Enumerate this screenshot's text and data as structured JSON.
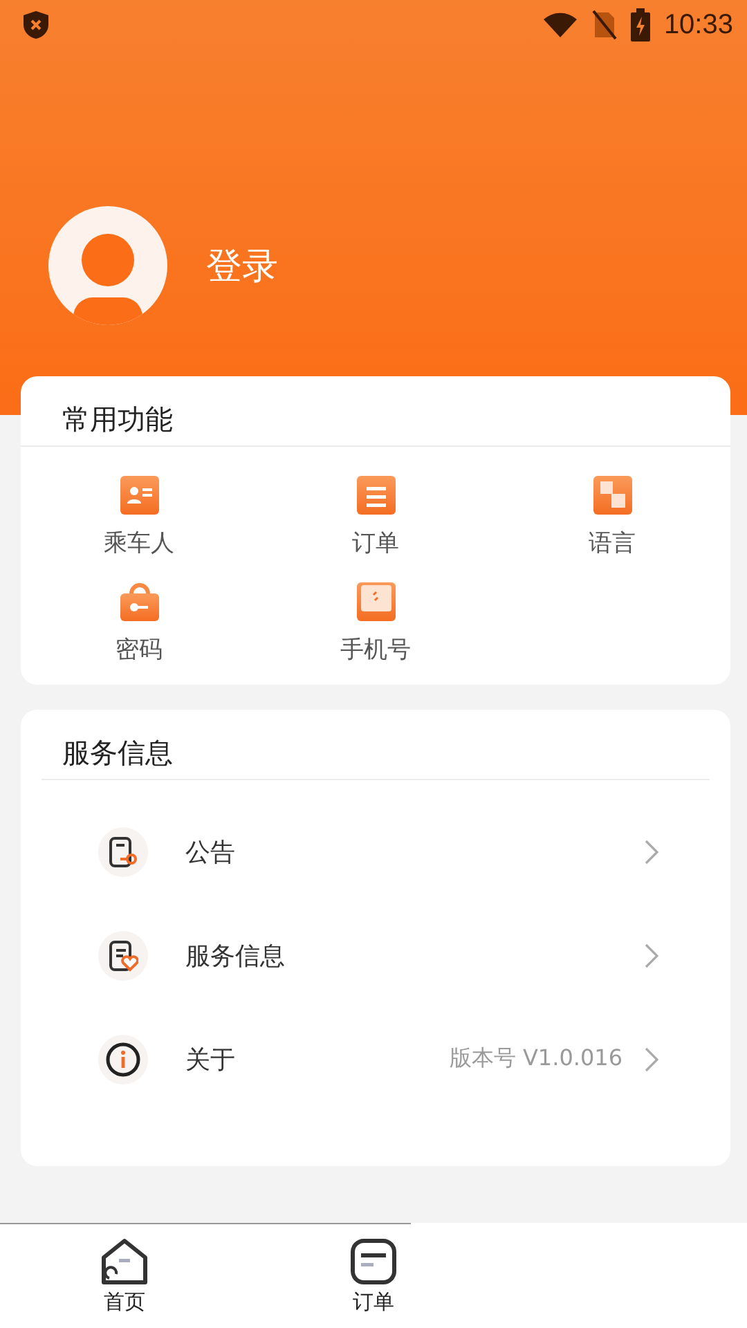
{
  "status_bar": {
    "time": "10:33"
  },
  "profile": {
    "login": "登录"
  },
  "common_functions": {
    "title": "常用功能",
    "items": [
      {
        "label": "乘车人"
      },
      {
        "label": "订单"
      },
      {
        "label": "语言"
      },
      {
        "label": "密码"
      },
      {
        "label": "手机号"
      }
    ]
  },
  "service_info": {
    "title": "服务信息",
    "rows": [
      {
        "label": "公告"
      },
      {
        "label": "服务信息"
      },
      {
        "label": "关于",
        "value": "版本号 V1.0.016"
      }
    ]
  },
  "bottom_nav": [
    {
      "label": "首页"
    },
    {
      "label": "订单"
    }
  ]
}
